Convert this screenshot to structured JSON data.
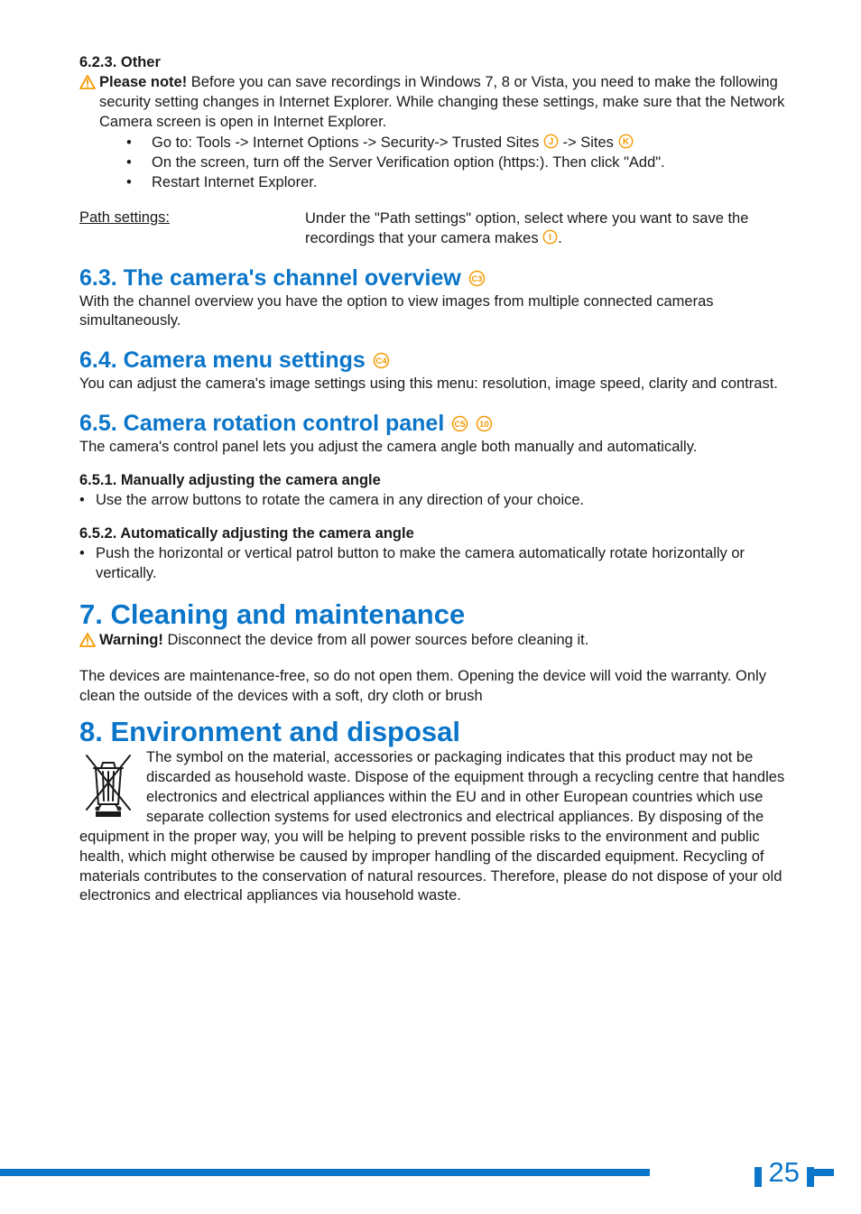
{
  "section_623": {
    "heading": "6.2.3.  Other",
    "note_label": "Please note!",
    "note_text": " Before you can save recordings in Windows 7, 8 or Vista, you need to make the following security setting changes in Internet Explorer. While changing these settings, make sure that the Network Camera screen is open in Internet Explorer.",
    "bullet1a": "Go to: Tools -> Internet Options -> Security-> Trusted Sites ",
    "bullet1b": " -> Sites ",
    "bullet2": "On the screen, turn off the Server Verification option (https:). Then click \"Add\".",
    "bullet3": "Restart Internet Explorer.",
    "path_term": "Path settings:",
    "path_desc_a": "Under the \"Path settings\" option, select where you want to save the recordings that your camera makes ",
    "path_desc_b": "."
  },
  "section_63": {
    "heading": "6.3.  The camera's channel overview",
    "body": "With the channel overview you have the option to view images from multiple connected cameras simultaneously."
  },
  "section_64": {
    "heading": "6.4.  Camera menu settings",
    "body": "You can adjust the camera's image settings using this menu: resolution, image speed, clarity and contrast."
  },
  "section_65": {
    "heading": "6.5.  Camera rotation control panel",
    "body": "The camera's control panel lets you adjust the camera angle both manually and automatically."
  },
  "section_651": {
    "heading": "6.5.1.  Manually adjusting the camera angle",
    "bullet": "Use the arrow buttons to rotate the camera in any direction of your choice."
  },
  "section_652": {
    "heading": "6.5.2.  Automatically adjusting the camera angle",
    "bullet": "Push the horizontal or vertical patrol button to make the camera automatically rotate horizontally or vertically."
  },
  "section_7": {
    "heading": "7. Cleaning and maintenance",
    "warn_label": "Warning!",
    "warn_text": " Disconnect the device from all power sources before cleaning it.",
    "body": "The devices are maintenance-free, so do not open them. Opening the device will void the warranty. Only clean the outside of the devices with a soft, dry cloth or brush"
  },
  "section_8": {
    "heading": "8. Environment and disposal",
    "body": " The symbol on the material, accessories or packaging indicates that this product may not be discarded as household waste. Dispose of the equipment through a recycling centre that handles electronics and electrical appliances within the EU and in other European countries which use separate collection systems for used electronics and electrical appliances. By disposing of the equipment in the proper way, you will be helping to prevent possible risks to the environment and public health, which might otherwise be caused by improper handling of the discarded equipment. Recycling of materials contributes to the conservation of natural resources. Therefore, please do not dispose of your old electronics and electrical appliances via household waste."
  },
  "icons": {
    "j": "J",
    "k": "K",
    "i": "I",
    "c3": "C3",
    "c4": "C4",
    "c5": "C5",
    "ten": "10"
  },
  "page_number": "25"
}
